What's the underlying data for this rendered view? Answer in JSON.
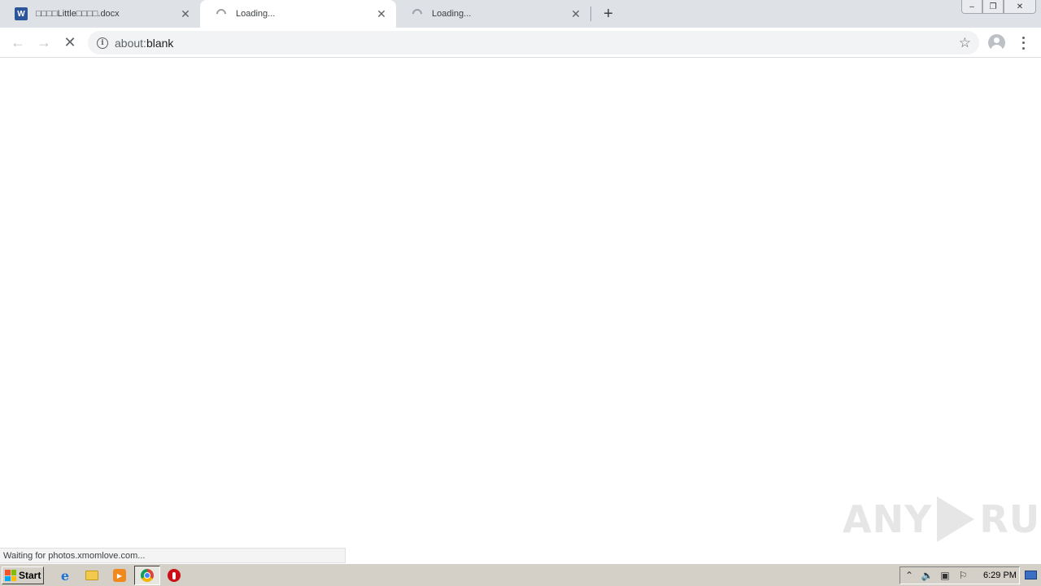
{
  "browser": {
    "tabs": [
      {
        "title": "□□□□Little□□□□.docx",
        "icon": "word-doc-icon",
        "active": false
      },
      {
        "title": "Loading...",
        "icon": "loading-spinner-icon",
        "active": true
      },
      {
        "title": "Loading...",
        "icon": "loading-spinner-icon",
        "active": false
      }
    ],
    "new_tab_label": "+",
    "window_controls": {
      "minimize": "–",
      "restore": "❐",
      "close": "✕"
    },
    "nav": {
      "back": "←",
      "forward": "→",
      "stop": "✕"
    },
    "address": {
      "scheme": "about:",
      "path": "blank",
      "info_glyph": "i"
    },
    "bookmark_glyph": "☆",
    "status_text": "Waiting for photos.xmomlove.com..."
  },
  "watermark": {
    "left": "ANY",
    "right": "RUN"
  },
  "taskbar": {
    "start_label": "Start",
    "pinned": [
      "internet-explorer-icon",
      "file-explorer-icon",
      "media-player-icon",
      "chrome-icon",
      "opera-icon"
    ],
    "tray_icons": [
      "tray-chevron-icon",
      "volume-icon",
      "network-icon",
      "action-center-flag-icon"
    ],
    "clock": "6:29 PM"
  },
  "colors": {
    "tab_strip": "#dee1e6",
    "taskbar": "#d4d0c8",
    "word_blue": "#2b579a"
  }
}
